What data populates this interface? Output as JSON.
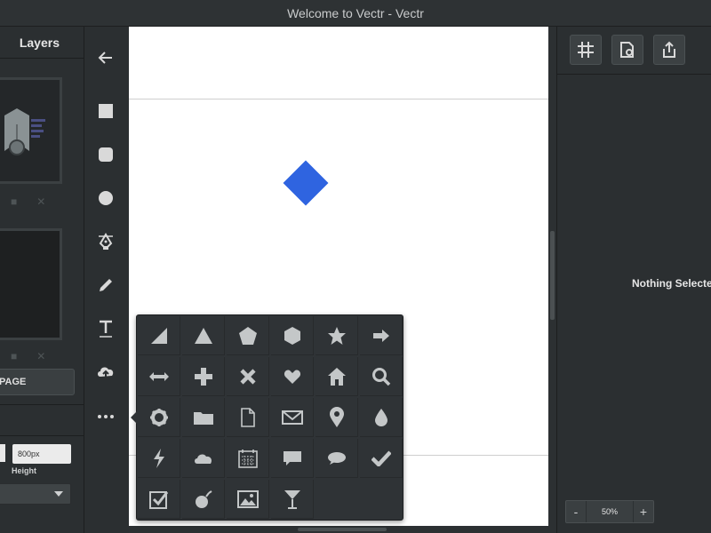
{
  "window": {
    "title": "Welcome to Vectr - Vectr"
  },
  "left_panel": {
    "tab_label": "Layers",
    "add_page_label": "PAGE",
    "height_value": "800px",
    "height_label": "Height"
  },
  "toolbar": {
    "tools": [
      "back-arrow-icon",
      "rectangle-icon",
      "rounded-rectangle-icon",
      "ellipse-icon",
      "pen-icon",
      "pencil-icon",
      "text-icon",
      "upload-icon",
      "more-icon"
    ]
  },
  "canvas": {
    "shape_color": "#2f64e0"
  },
  "right_panel": {
    "buttons": [
      "grid-icon",
      "page-settings-icon",
      "share-icon"
    ],
    "empty_message": "Nothing Selected",
    "zoom_minus": "-",
    "zoom_value": "50%",
    "zoom_plus": "+"
  },
  "shapes_popup": {
    "shapes": [
      "right-triangle-icon",
      "triangle-icon",
      "pentagon-icon",
      "hexagon-icon",
      "star-icon",
      "arrow-right-icon",
      "double-arrow-icon",
      "plus-icon",
      "x-icon",
      "heart-icon",
      "home-icon",
      "search-icon",
      "gear-icon",
      "folder-icon",
      "document-icon",
      "mail-icon",
      "map-pin-icon",
      "droplet-icon",
      "lightning-icon",
      "cloud-icon",
      "calendar-icon",
      "chat-bubble-icon",
      "speech-oval-icon",
      "checkmark-icon",
      "checkbox-icon",
      "bomb-icon",
      "image-icon",
      "cocktail-icon"
    ]
  }
}
